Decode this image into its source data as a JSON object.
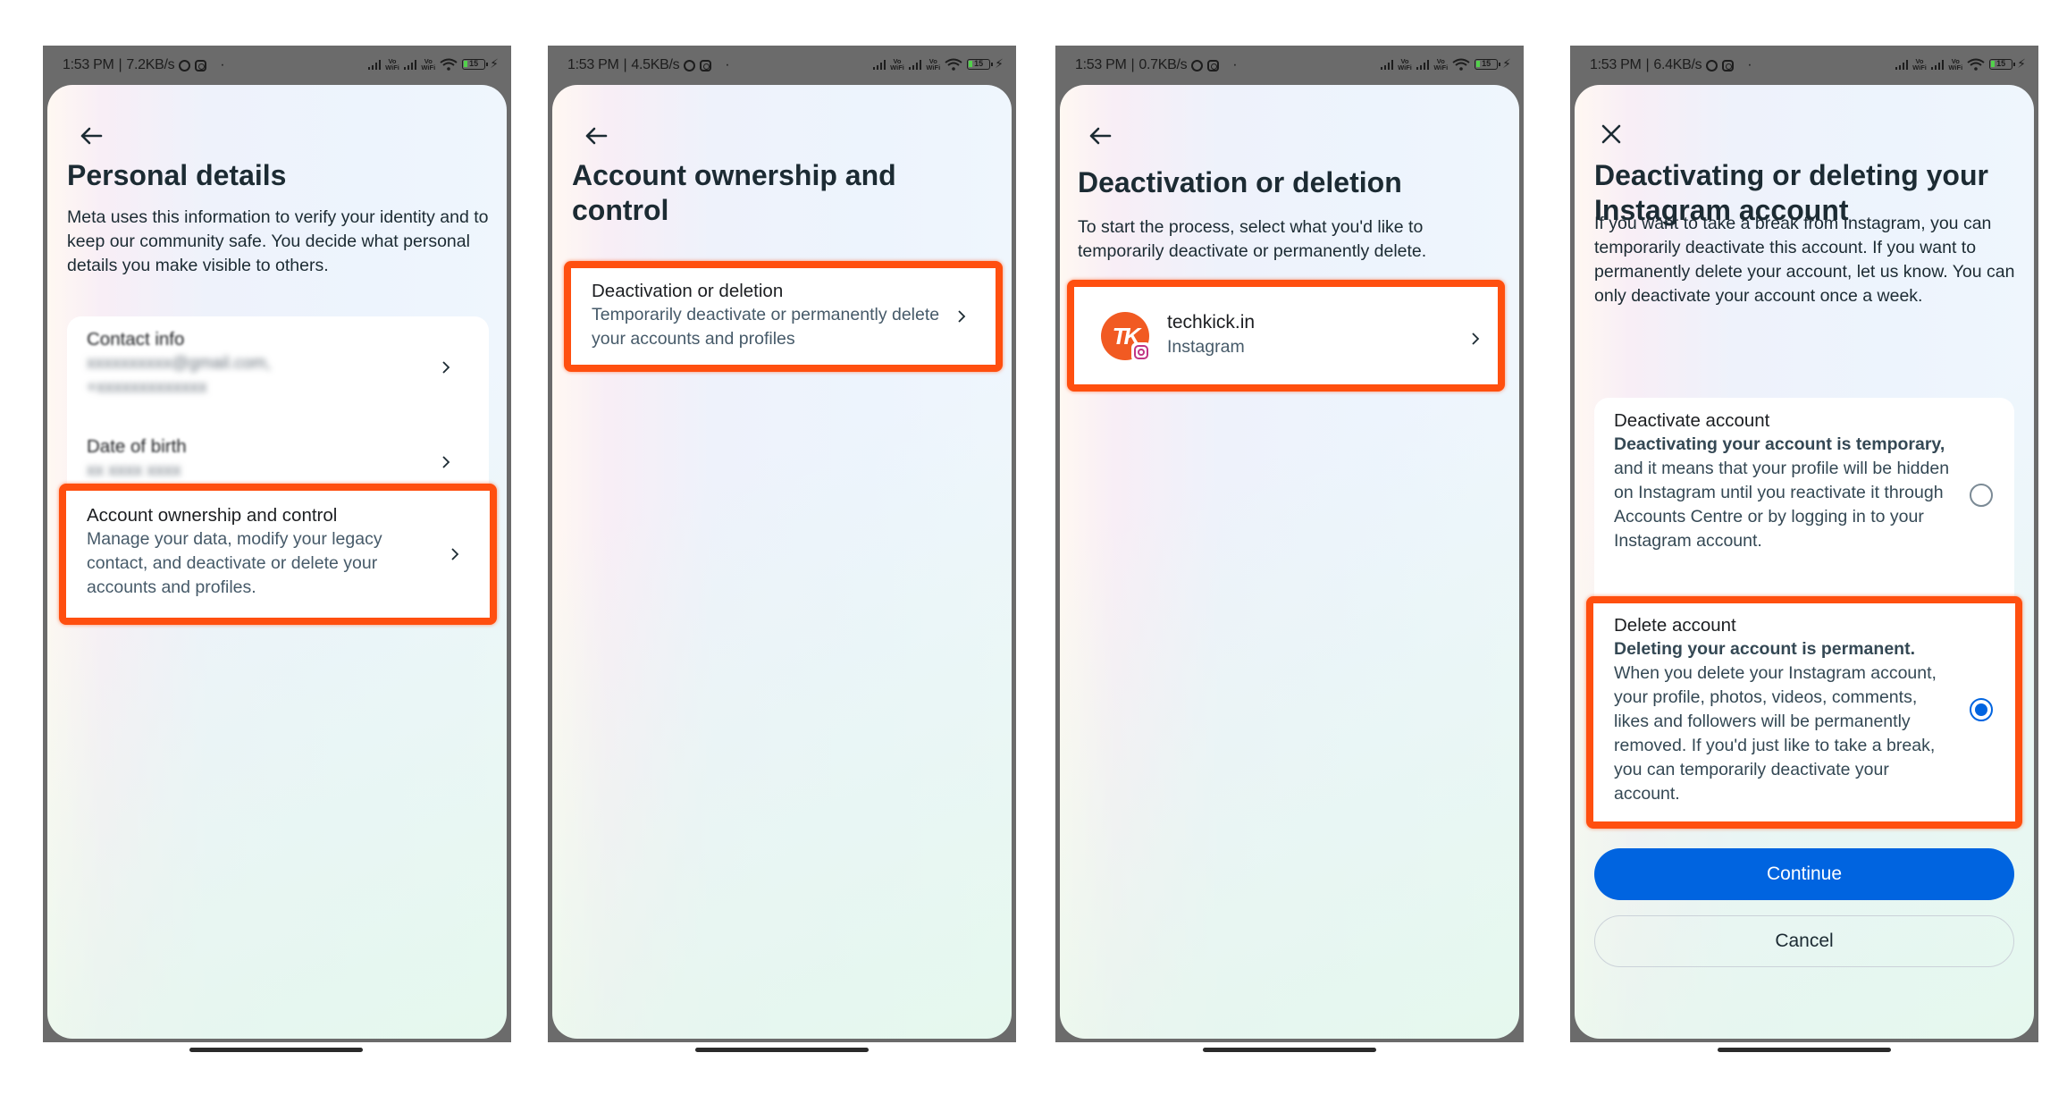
{
  "screens": [
    {
      "status": {
        "time": "1:53 PM",
        "speed": "7.2KB/s",
        "vo_label": "Vo",
        "wifi_label": "WiFi",
        "battery": "15"
      },
      "nav_icon": "back-arrow-icon",
      "title": "Personal details",
      "description": "Meta uses this information to verify your identity and to keep our community safe. You decide what personal details you make visible to others.",
      "items": [
        {
          "title": "Contact info",
          "values": [
            "xxxxxxxxxx@gmail.com,",
            "+xxxxxxxxxxxxx"
          ],
          "obscured": true
        },
        {
          "title": "Date of birth",
          "values": [
            "xx xxxx xxxx"
          ],
          "obscured": true
        },
        {
          "title": "Account ownership and control",
          "subtitle": "Manage your data, modify your legacy contact, and deactivate or delete your accounts and profiles.",
          "highlighted": true
        }
      ]
    },
    {
      "status": {
        "time": "1:53 PM",
        "speed": "4.5KB/s",
        "vo_label": "Vo",
        "wifi_label": "WiFi",
        "battery": "15"
      },
      "nav_icon": "back-arrow-icon",
      "title": "Account ownership and control",
      "items": [
        {
          "title": "Deactivation or deletion",
          "subtitle": "Temporarily deactivate or permanently delete your accounts and profiles",
          "highlighted": true
        }
      ]
    },
    {
      "status": {
        "time": "1:53 PM",
        "speed": "0.7KB/s",
        "vo_label": "Vo",
        "wifi_label": "WiFi",
        "battery": "15"
      },
      "nav_icon": "back-arrow-icon",
      "title": "Deactivation or deletion",
      "description": "To start the process, select what you'd like to temporarily deactivate or permanently delete.",
      "accounts": [
        {
          "name": "techkick.in",
          "platform": "Instagram",
          "avatar_initials": "TK",
          "avatar_color": "#f15a22",
          "highlighted": true
        }
      ]
    },
    {
      "status": {
        "time": "1:53 PM",
        "speed": "6.4KB/s",
        "vo_label": "Vo",
        "wifi_label": "WiFi",
        "battery": "15"
      },
      "nav_icon": "close-icon",
      "title": "Deactivating or deleting your Instagram account",
      "description": "If you want to take a break from Instagram, you can temporarily deactivate this account. If you want to permanently delete your account, let us know.  You can only deactivate your account once a week.",
      "options": [
        {
          "title": "Deactivate account",
          "bold_text": "Deactivating your account is temporary,",
          "text": " and it means that your profile will be hidden on Instagram until you reactivate it through Accounts Centre or by logging in to your Instagram account.",
          "selected": false
        },
        {
          "title": "Delete account",
          "bold_text": "Deleting your account is permanent.",
          "text": " When you delete your Instagram account, your profile, photos, videos, comments, likes and followers will be permanently removed. If you'd just like to take a break, you can temporarily deactivate your account.",
          "selected": true,
          "highlighted": true
        }
      ],
      "buttons": {
        "continue": "Continue",
        "cancel": "Cancel"
      }
    }
  ],
  "colors": {
    "primary": "#0064e0",
    "highlight": "#ff4f0f",
    "frame": "#6b6b6b"
  }
}
